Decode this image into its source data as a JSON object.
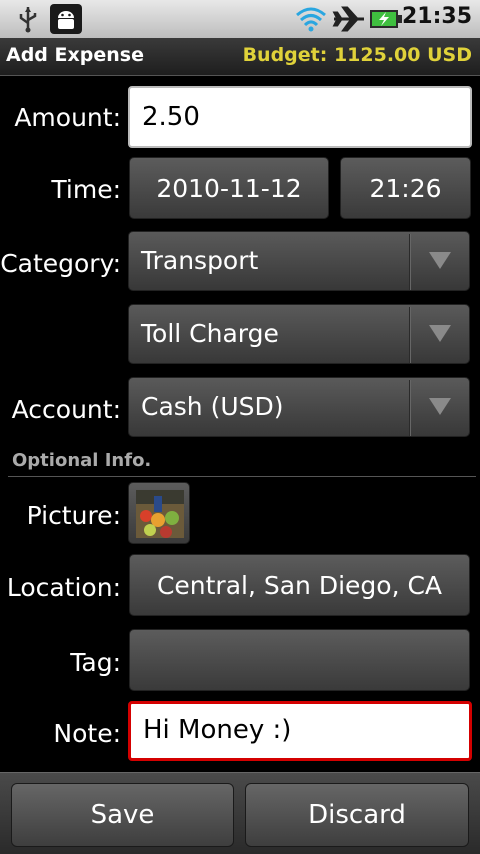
{
  "status_bar": {
    "time": "21:35",
    "icons": [
      "usb-icon",
      "android-debug-icon",
      "wifi-icon",
      "airplane-icon",
      "battery-charging-icon"
    ]
  },
  "title_bar": {
    "title": "Add Expense",
    "budget": "Budget: 1125.00 USD",
    "budget_color": "#e0d23a"
  },
  "form": {
    "amount_label": "Amount:",
    "amount_value": "2.50",
    "time_label": "Time:",
    "date_value": "2010-11-12",
    "time_value": "21:26",
    "category_label": "Category:",
    "category_value": "Transport",
    "subcategory_value": "Toll Charge",
    "account_label": "Account:",
    "account_value": "Cash (USD)"
  },
  "optional": {
    "section_title": "Optional Info.",
    "picture_label": "Picture:",
    "location_label": "Location:",
    "location_value": "Central, San Diego, CA",
    "tag_label": "Tag:",
    "tag_value": "",
    "note_label": "Note:",
    "note_value": "Hi Money :)",
    "note_focus_color": "#d40000"
  },
  "actions": {
    "save_label": "Save",
    "discard_label": "Discard"
  }
}
